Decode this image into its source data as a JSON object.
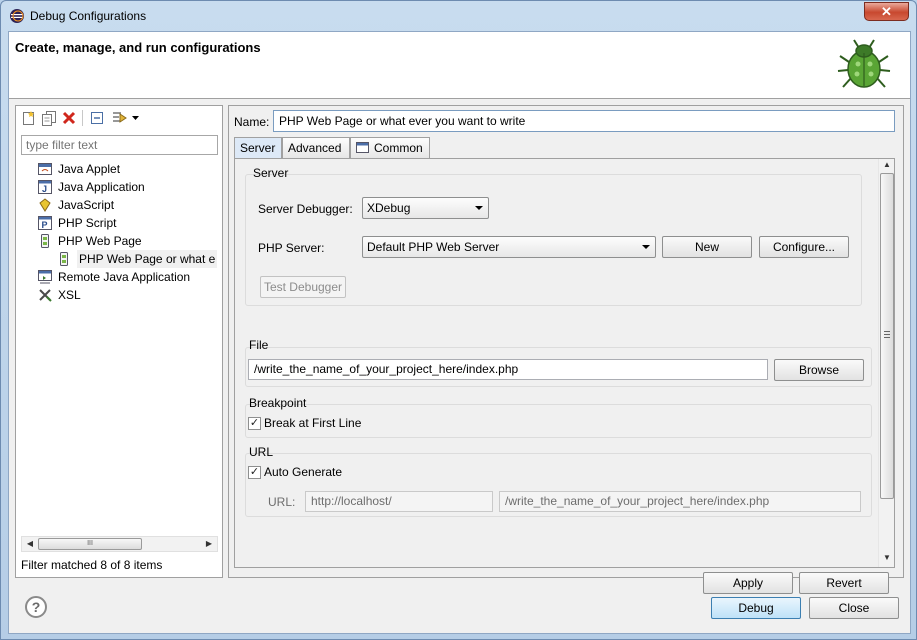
{
  "window": {
    "title": "Debug Configurations",
    "close_label": "✕"
  },
  "header": {
    "title": "Create, manage, and run configurations"
  },
  "sidebar": {
    "filter_placeholder": "type filter text",
    "items": [
      {
        "label": "Java Applet",
        "icon": "java-applet-icon"
      },
      {
        "label": "Java Application",
        "icon": "java-application-icon"
      },
      {
        "label": "JavaScript",
        "icon": "javascript-icon"
      },
      {
        "label": "PHP Script",
        "icon": "php-script-icon"
      },
      {
        "label": "PHP Web Page",
        "icon": "php-web-page-icon"
      },
      {
        "label": "PHP Web Page  or what e",
        "icon": "php-web-page-config-icon",
        "selected": true
      },
      {
        "label": "Remote Java Application",
        "icon": "remote-java-icon"
      },
      {
        "label": "XSL",
        "icon": "xsl-icon"
      }
    ],
    "status": "Filter matched 8 of 8 items",
    "scroll_thumb_label": "III"
  },
  "config": {
    "name_label": "Name:",
    "name_value": "PHP Web Page or what ever you want to write",
    "tabs": [
      "Server",
      "Advanced",
      "Common"
    ],
    "server_group": {
      "title": "Server",
      "debugger_label": "Server Debugger:",
      "debugger_value": "XDebug",
      "php_server_label": "PHP Server:",
      "php_server_value": "Default PHP Web Server",
      "new_label": "New",
      "configure_label": "Configure...",
      "test_label": "Test Debugger"
    },
    "file_group": {
      "title": "File",
      "path": "/write_the_name_of_your_project_here/index.php",
      "browse_label": "Browse"
    },
    "breakpoint_group": {
      "title": "Breakpoint",
      "break_first_line_label": "Break at First Line",
      "break_first_line_checked": true
    },
    "url_group": {
      "title": "URL",
      "auto_generate_label": "Auto Generate",
      "auto_generate_checked": true,
      "url_label": "URL:",
      "url_base": "http://localhost/",
      "url_path": "/write_the_name_of_your_project_here/index.php"
    },
    "apply_label": "Apply",
    "revert_label": "Revert"
  },
  "footer": {
    "help_label": "?",
    "debug_label": "Debug",
    "close_label": "Close"
  },
  "colors": {
    "accent": "#3c7fb1",
    "close_button": "#c8482f",
    "window_frame": "#b5cde6"
  }
}
